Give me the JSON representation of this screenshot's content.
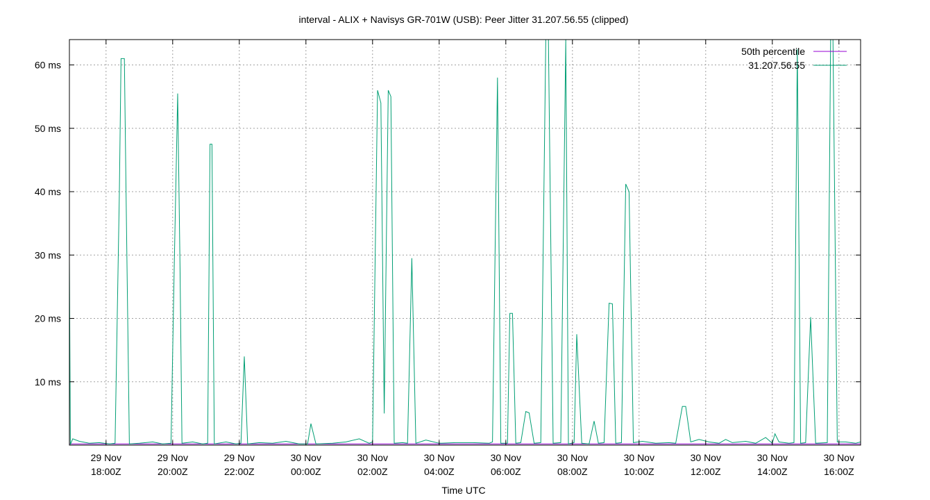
{
  "chart_data": {
    "type": "line",
    "title": "interval - ALIX + Navisys GR-701W (USB): Peer Jitter 31.207.56.55 (clipped)",
    "xlabel": "Time UTC",
    "ylabel": "",
    "x_unit": "hours since 29 Nov 17:00Z",
    "xlim": [
      16.9,
      40.65
    ],
    "ylim": [
      0,
      64
    ],
    "y_ticks": [
      {
        "value": 10,
        "label": "10 ms"
      },
      {
        "value": 20,
        "label": "20 ms"
      },
      {
        "value": 30,
        "label": "30 ms"
      },
      {
        "value": 40,
        "label": "40 ms"
      },
      {
        "value": 50,
        "label": "50 ms"
      },
      {
        "value": 60,
        "label": "60 ms"
      }
    ],
    "x_ticks": [
      {
        "value": 18,
        "line1": "29 Nov",
        "line2": "18:00Z"
      },
      {
        "value": 20,
        "line1": "29 Nov",
        "line2": "20:00Z"
      },
      {
        "value": 22,
        "line1": "29 Nov",
        "line2": "22:00Z"
      },
      {
        "value": 24,
        "line1": "30 Nov",
        "line2": "00:00Z"
      },
      {
        "value": 26,
        "line1": "30 Nov",
        "line2": "02:00Z"
      },
      {
        "value": 28,
        "line1": "30 Nov",
        "line2": "04:00Z"
      },
      {
        "value": 30,
        "line1": "30 Nov",
        "line2": "06:00Z"
      },
      {
        "value": 32,
        "line1": "30 Nov",
        "line2": "08:00Z"
      },
      {
        "value": 34,
        "line1": "30 Nov",
        "line2": "10:00Z"
      },
      {
        "value": 36,
        "line1": "30 Nov",
        "line2": "12:00Z"
      },
      {
        "value": 38,
        "line1": "30 Nov",
        "line2": "14:00Z"
      },
      {
        "value": 40,
        "line1": "30 Nov",
        "line2": "16:00Z"
      }
    ],
    "grid": true,
    "legend_position": "top-right",
    "series": [
      {
        "name": "50th percentile",
        "color": "#9400d3",
        "points": [
          [
            16.9,
            0.2
          ],
          [
            40.65,
            0.2
          ]
        ]
      },
      {
        "name": "31.207.56.55",
        "color": "#009e73",
        "points": [
          [
            16.9,
            29.5
          ],
          [
            16.93,
            0.1
          ],
          [
            17.0,
            1.0
          ],
          [
            17.2,
            0.6
          ],
          [
            17.5,
            0.3
          ],
          [
            17.8,
            0.4
          ],
          [
            18.1,
            0.2
          ],
          [
            18.27,
            0.3
          ],
          [
            18.4,
            40
          ],
          [
            18.45,
            61
          ],
          [
            18.55,
            61
          ],
          [
            18.6,
            40
          ],
          [
            18.7,
            0.2
          ],
          [
            19.0,
            0.3
          ],
          [
            19.4,
            0.5
          ],
          [
            19.7,
            0.2
          ],
          [
            19.95,
            0.3
          ],
          [
            20.05,
            29
          ],
          [
            20.15,
            55.5
          ],
          [
            20.22,
            28
          ],
          [
            20.28,
            0.3
          ],
          [
            20.6,
            0.5
          ],
          [
            20.9,
            0.2
          ],
          [
            21.05,
            0.3
          ],
          [
            21.12,
            47.5
          ],
          [
            21.18,
            47.5
          ],
          [
            21.25,
            0.2
          ],
          [
            21.6,
            0.5
          ],
          [
            21.9,
            0.2
          ],
          [
            22.05,
            0.3
          ],
          [
            22.15,
            14
          ],
          [
            22.25,
            0.2
          ],
          [
            22.6,
            0.4
          ],
          [
            23.0,
            0.3
          ],
          [
            23.4,
            0.6
          ],
          [
            23.8,
            0.2
          ],
          [
            24.05,
            0.2
          ],
          [
            24.15,
            3.4
          ],
          [
            24.3,
            0.2
          ],
          [
            24.8,
            0.3
          ],
          [
            25.2,
            0.5
          ],
          [
            25.6,
            1.0
          ],
          [
            25.9,
            0.3
          ],
          [
            26.0,
            0.5
          ],
          [
            26.15,
            56
          ],
          [
            26.25,
            54
          ],
          [
            26.35,
            5
          ],
          [
            26.47,
            56
          ],
          [
            26.55,
            55
          ],
          [
            26.65,
            0.3
          ],
          [
            26.9,
            0.4
          ],
          [
            27.05,
            0.3
          ],
          [
            27.18,
            29.5
          ],
          [
            27.3,
            0.3
          ],
          [
            27.6,
            0.8
          ],
          [
            28.0,
            0.3
          ],
          [
            28.5,
            0.4
          ],
          [
            29.0,
            0.4
          ],
          [
            29.5,
            0.3
          ],
          [
            29.6,
            0.5
          ],
          [
            29.75,
            58
          ],
          [
            29.85,
            0.3
          ],
          [
            30.05,
            0.3
          ],
          [
            30.12,
            20.8
          ],
          [
            30.2,
            20.8
          ],
          [
            30.3,
            0.3
          ],
          [
            30.45,
            0.4
          ],
          [
            30.6,
            5.3
          ],
          [
            30.7,
            5.1
          ],
          [
            30.85,
            0.3
          ],
          [
            31.05,
            0.4
          ],
          [
            31.2,
            64
          ],
          [
            31.28,
            64
          ],
          [
            31.42,
            0.3
          ],
          [
            31.65,
            0.4
          ],
          [
            31.8,
            64
          ],
          [
            31.88,
            0.2
          ],
          [
            32.05,
            0.4
          ],
          [
            32.13,
            17.5
          ],
          [
            32.28,
            0.3
          ],
          [
            32.5,
            0.2
          ],
          [
            32.65,
            3.8
          ],
          [
            32.78,
            0.3
          ],
          [
            32.95,
            0.4
          ],
          [
            33.1,
            22.4
          ],
          [
            33.2,
            22.3
          ],
          [
            33.3,
            0.3
          ],
          [
            33.47,
            0.4
          ],
          [
            33.6,
            41.2
          ],
          [
            33.7,
            40
          ],
          [
            33.83,
            0.4
          ],
          [
            34.1,
            0.6
          ],
          [
            34.5,
            0.3
          ],
          [
            34.9,
            0.4
          ],
          [
            35.1,
            0.3
          ],
          [
            35.3,
            6.1
          ],
          [
            35.4,
            6.1
          ],
          [
            35.55,
            0.5
          ],
          [
            35.8,
            0.9
          ],
          [
            36.1,
            0.5
          ],
          [
            36.4,
            0.3
          ],
          [
            36.6,
            0.9
          ],
          [
            36.8,
            0.4
          ],
          [
            37.2,
            0.6
          ],
          [
            37.5,
            0.3
          ],
          [
            37.8,
            1.2
          ],
          [
            38.0,
            0.3
          ],
          [
            38.08,
            1.8
          ],
          [
            38.2,
            0.5
          ],
          [
            38.5,
            0.3
          ],
          [
            38.65,
            0.4
          ],
          [
            38.75,
            62.5
          ],
          [
            38.85,
            0.3
          ],
          [
            39.0,
            0.4
          ],
          [
            39.15,
            20.2
          ],
          [
            39.3,
            0.3
          ],
          [
            39.65,
            0.4
          ],
          [
            39.75,
            64
          ],
          [
            39.82,
            64
          ],
          [
            39.95,
            0.5
          ],
          [
            40.2,
            0.5
          ],
          [
            40.5,
            0.3
          ],
          [
            40.65,
            0.5
          ]
        ]
      }
    ]
  }
}
